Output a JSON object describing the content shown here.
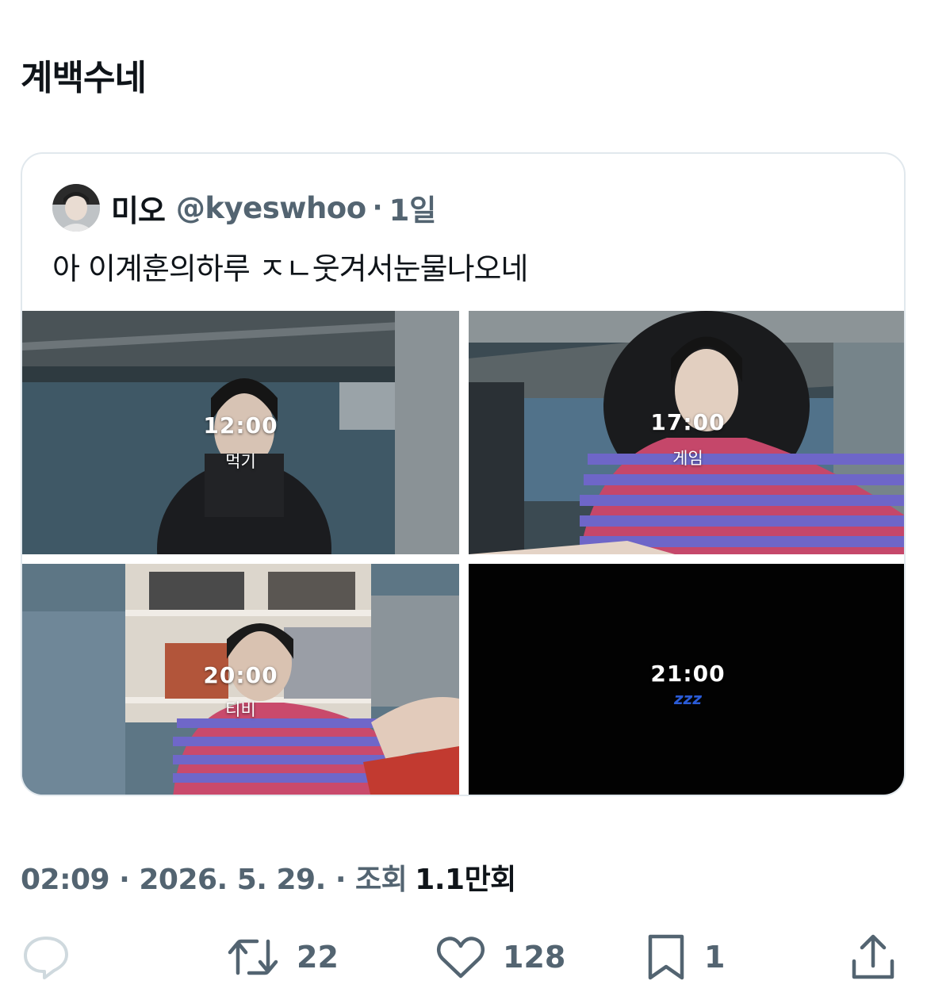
{
  "tweet": {
    "text": "계백수네"
  },
  "quote": {
    "display_name": "미오",
    "handle": "@kyeswhoo",
    "age": "1일",
    "text": "아 이계훈의하루 ㅈㄴ웃겨서눈물나오네",
    "media": [
      {
        "time": "12:00",
        "activity": "먹기"
      },
      {
        "time": "17:00",
        "activity": "게임"
      },
      {
        "time": "20:00",
        "activity": "티비"
      },
      {
        "time": "21:00",
        "activity": "zzz"
      }
    ]
  },
  "meta": {
    "time": "02:09",
    "date": "2026. 5. 29.",
    "views_label": "조회",
    "views_count": "1.1",
    "views_unit": "만회"
  },
  "actions": {
    "reply_count": "",
    "retweet_count": "22",
    "like_count": "128",
    "bookmark_count": "1"
  },
  "colors": {
    "text": "#0f1419",
    "secondary": "#536471",
    "border": "#e1e8ed",
    "reply_icon": "#cfd9de"
  },
  "icons": [
    "reply-icon",
    "retweet-icon",
    "like-icon",
    "bookmark-icon",
    "share-icon"
  ]
}
